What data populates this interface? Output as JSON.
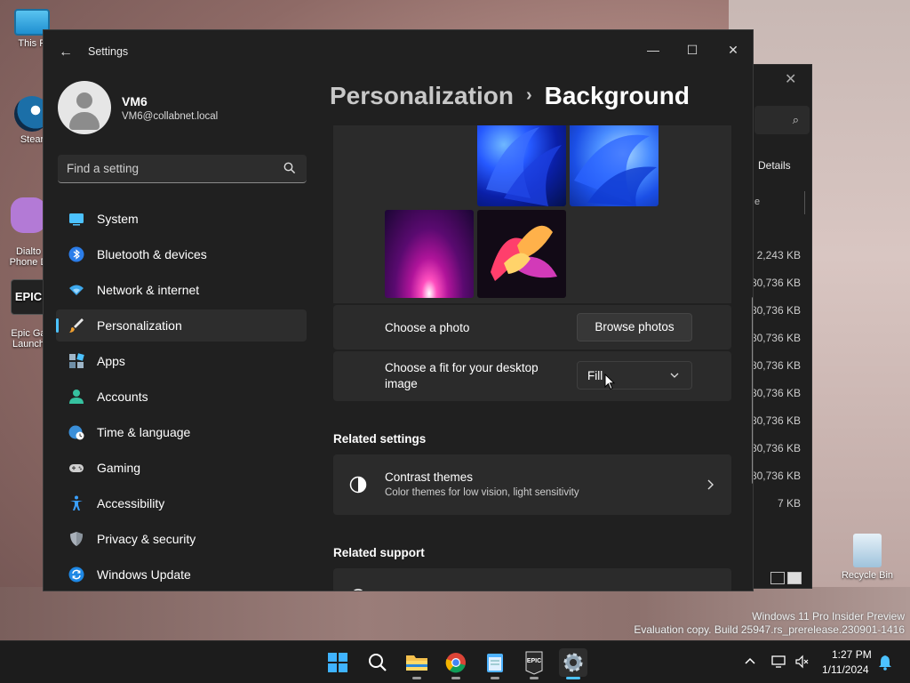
{
  "desktop": {
    "icons": [
      {
        "label": "This P"
      },
      {
        "label": "Stear"
      },
      {
        "label": "Dialto\nPhone D"
      },
      {
        "label": "Epic Ga\nLaunch"
      },
      {
        "label": "Recycle Bin"
      }
    ],
    "watermark": {
      "line1": "Windows 11 Pro Insider Preview",
      "line2": "Evaluation copy. Build 25947.rs_prerelease.230901-1416"
    }
  },
  "explorer": {
    "details_label": "Details",
    "col_header_fragment": "e",
    "sizes": [
      "2,243 KB",
      "80,736 KB",
      "80,736 KB",
      "80,736 KB",
      "80,736 KB",
      "80,736 KB",
      "80,736 KB",
      "80,736 KB",
      "80,736 KB",
      "7 KB"
    ]
  },
  "settings": {
    "app_title": "Settings",
    "user": {
      "name": "VM6",
      "email": "VM6@collabnet.local"
    },
    "search": {
      "placeholder": "Find a setting"
    },
    "nav": [
      {
        "label": "System",
        "icon": "system-icon",
        "active": false
      },
      {
        "label": "Bluetooth & devices",
        "icon": "bluetooth-icon",
        "active": false
      },
      {
        "label": "Network & internet",
        "icon": "wifi-icon",
        "active": false
      },
      {
        "label": "Personalization",
        "icon": "brush-icon",
        "active": true
      },
      {
        "label": "Apps",
        "icon": "apps-icon",
        "active": false
      },
      {
        "label": "Accounts",
        "icon": "accounts-icon",
        "active": false
      },
      {
        "label": "Time & language",
        "icon": "globe-clock-icon",
        "active": false
      },
      {
        "label": "Gaming",
        "icon": "gamepad-icon",
        "active": false
      },
      {
        "label": "Accessibility",
        "icon": "accessibility-icon",
        "active": false
      },
      {
        "label": "Privacy & security",
        "icon": "shield-icon",
        "active": false
      },
      {
        "label": "Windows Update",
        "icon": "update-icon",
        "active": false
      }
    ],
    "breadcrumb": {
      "parent": "Personalization",
      "separator": "›",
      "current": "Background"
    },
    "choose_photo": {
      "label": "Choose a photo",
      "button": "Browse photos"
    },
    "fit": {
      "label": "Choose a fit for your desktop\nimage",
      "value": "Fill"
    },
    "related_settings": {
      "heading": "Related settings",
      "item_title": "Contrast themes",
      "item_subtitle": "Color themes for low vision, light sensitivity"
    },
    "related_support": {
      "heading": "Related support"
    }
  },
  "taskbar": {
    "time": "1:27 PM",
    "date": "1/11/2024",
    "apps": [
      "start-icon",
      "search-icon",
      "file-explorer-icon",
      "chrome-icon",
      "notepad-icon",
      "epic-games-icon",
      "settings-icon"
    ]
  }
}
